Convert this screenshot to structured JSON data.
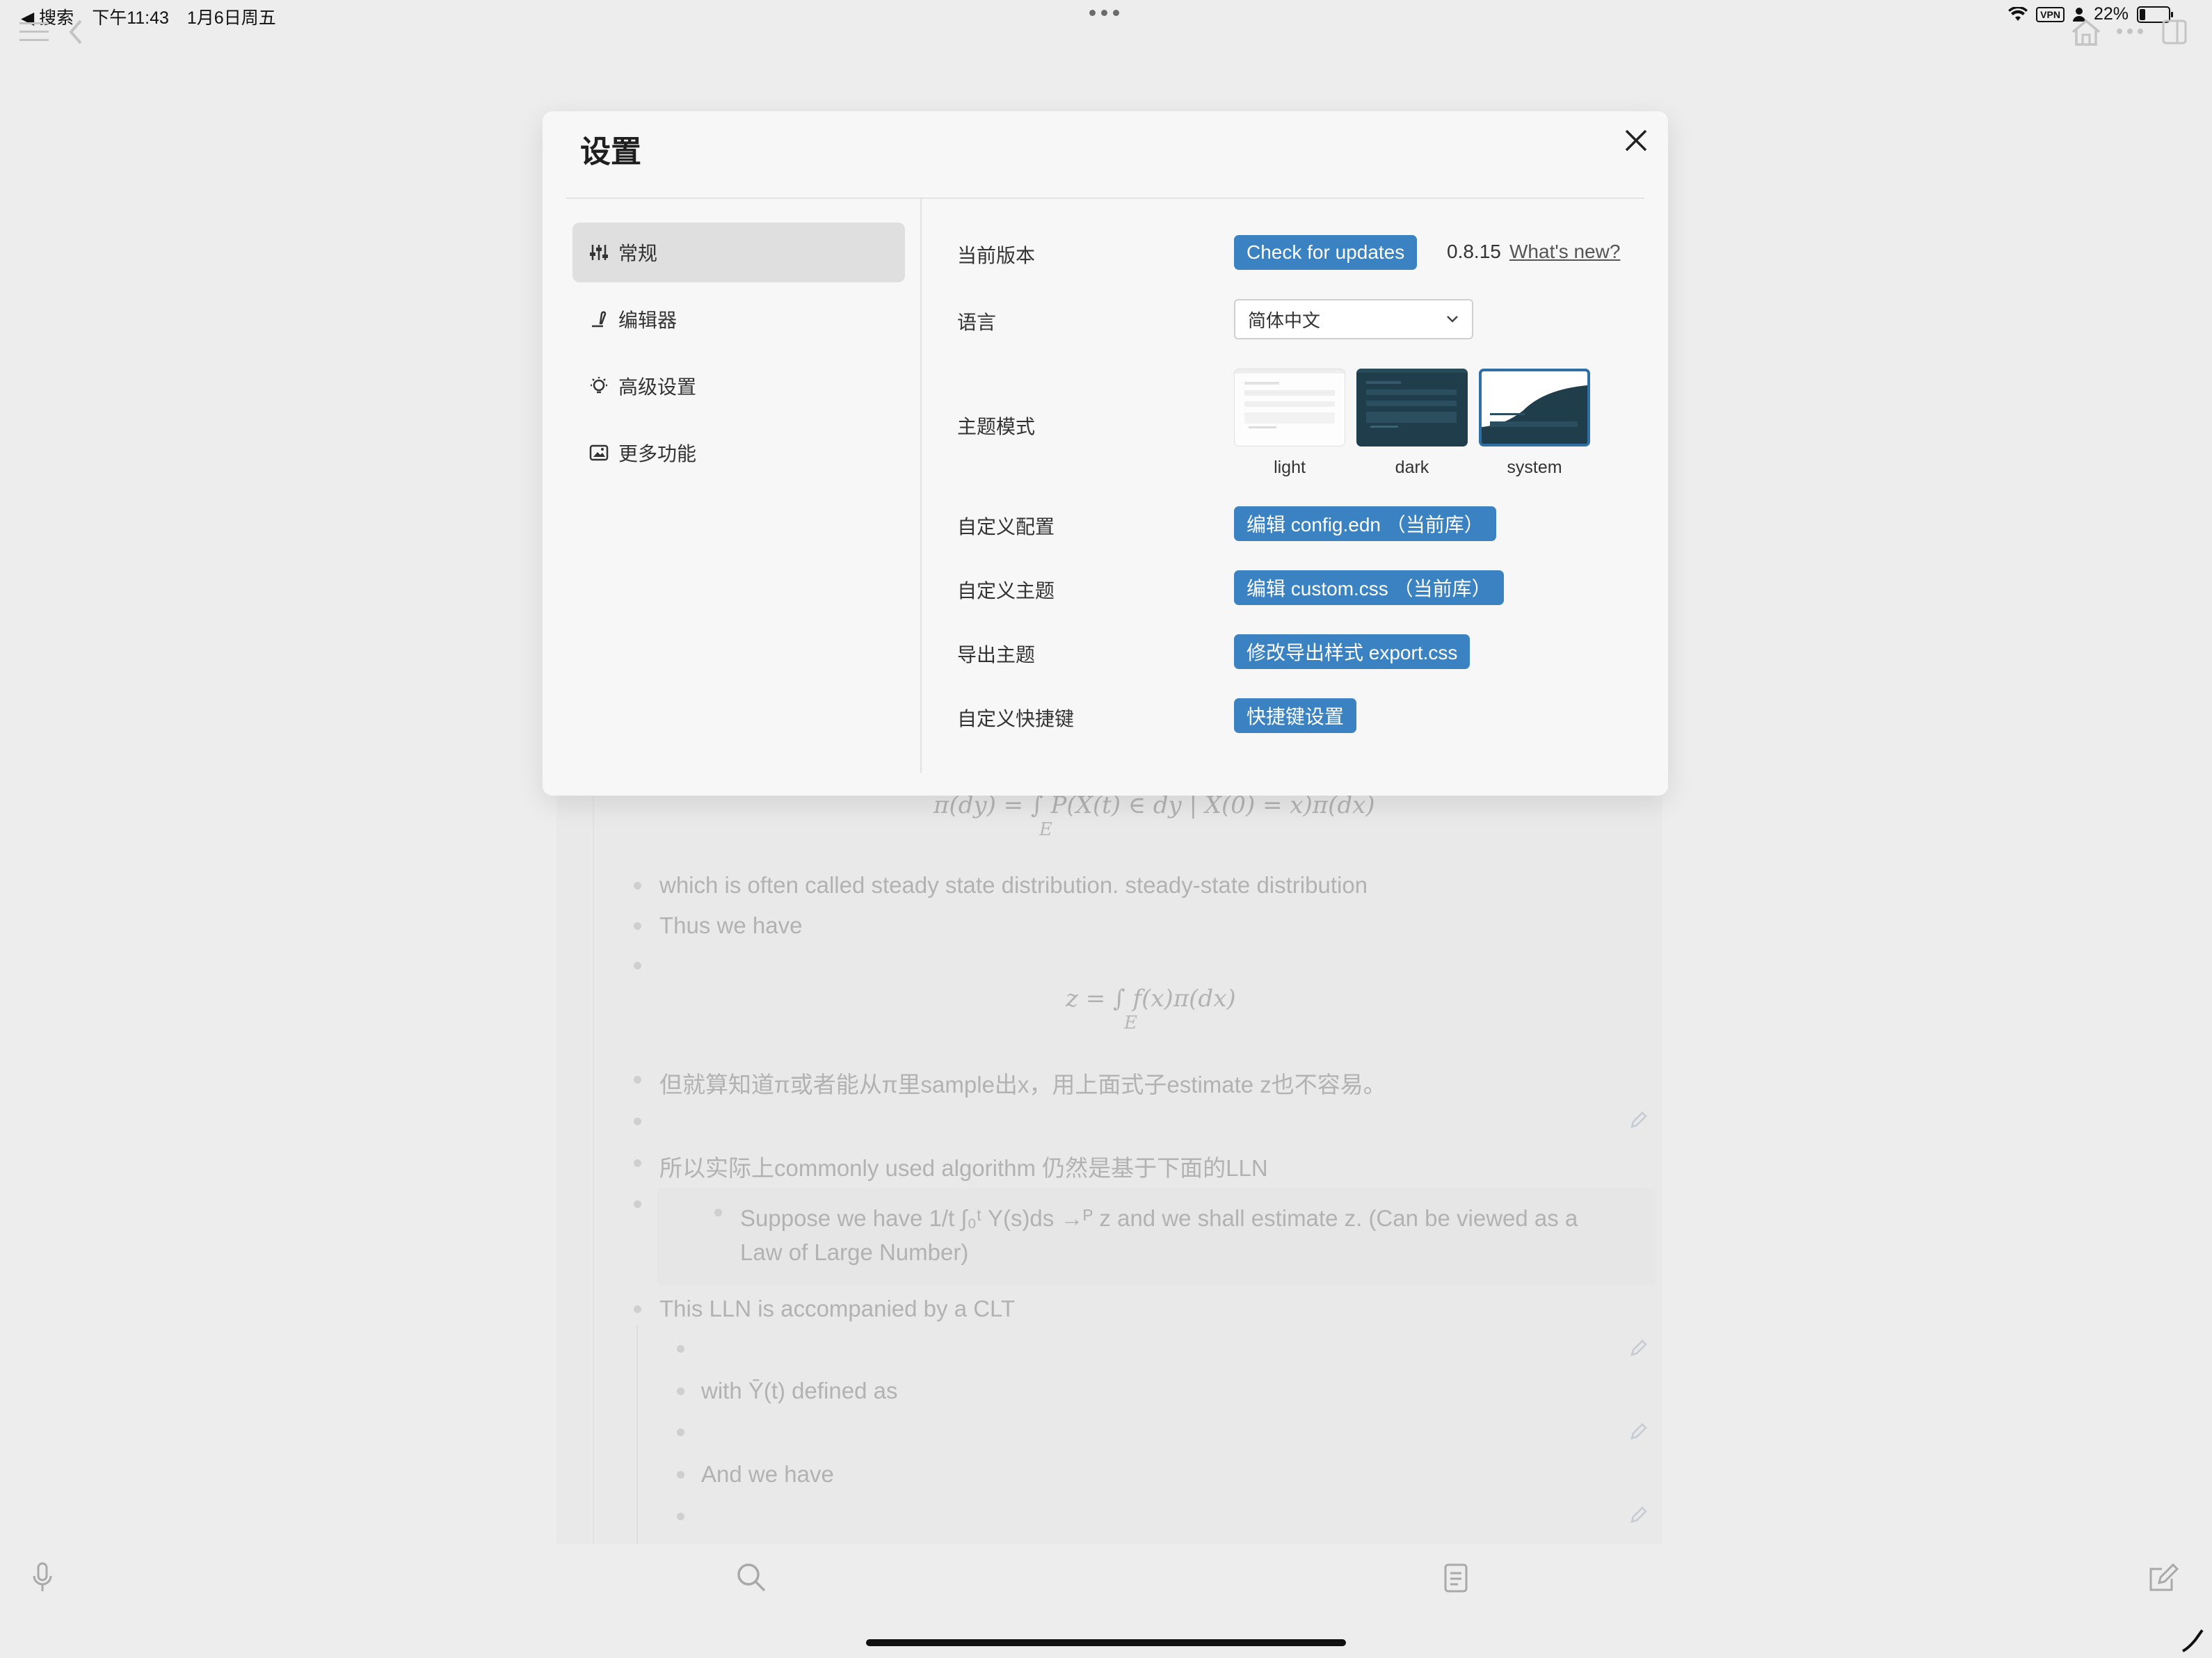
{
  "status_bar": {
    "back_app": "◀ 搜索",
    "time": "下午11:43",
    "date": "1月6日周五",
    "vpn": "VPN",
    "battery": "22%",
    "battery_level": 0.22
  },
  "document": {
    "formula_top": "π(dy) = ∫  P(X(t) ∈ dy | X(0) = x)π(dx)",
    "formula_top_sub": "E",
    "line1": "which is often called steady state distribution. steady-state distribution",
    "line2": "Thus we have",
    "formula_z": "z = ∫  f(x)π(dx)",
    "formula_z_sub": "E",
    "line3": "但就算知道π或者能从π里sample出x，用上面式子estimate z也不容易。",
    "line4": "所以实际上commonly used algorithm 仍然是基于下面的LLN",
    "quote_line1": "Suppose we have 1/t ∫₀ᵗ Y(s)ds →ᴾ z and we shall estimate z. (Can be viewed as a",
    "quote_line2": "Law of Large Number)",
    "line5": "This LLN is accompanied by a CLT",
    "nested1": "with Ȳ(t) defined as",
    "nested2": "And we have"
  },
  "settings": {
    "title": "设置",
    "nav": [
      {
        "label": "常规",
        "icon": "sliders-icon",
        "active": true
      },
      {
        "label": "编辑器",
        "icon": "pen-icon",
        "active": false
      },
      {
        "label": "高级设置",
        "icon": "bulb-icon",
        "active": false
      },
      {
        "label": "更多功能",
        "icon": "gallery-icon",
        "active": false
      }
    ],
    "version": {
      "label": "当前版本",
      "button": "Check for updates",
      "number": "0.8.15",
      "whats_new": "What's new?"
    },
    "language": {
      "label": "语言",
      "value": "简体中文"
    },
    "theme": {
      "label": "主题模式",
      "options": [
        "light",
        "dark",
        "system"
      ],
      "selected": "system"
    },
    "custom_config": {
      "label": "自定义配置",
      "button": "编辑 config.edn （当前库）"
    },
    "custom_theme": {
      "label": "自定义主题",
      "button": "编辑 custom.css （当前库）"
    },
    "export_theme": {
      "label": "导出主题",
      "button": "修改导出样式 export.css"
    },
    "shortcuts": {
      "label": "自定义快捷键",
      "button": "快捷键设置"
    }
  },
  "colors": {
    "accent": "#3a82c2",
    "modal_bg": "#f7f7f7",
    "backdrop": "#ededed",
    "dark_theme_preview": "#1f3d4a"
  }
}
